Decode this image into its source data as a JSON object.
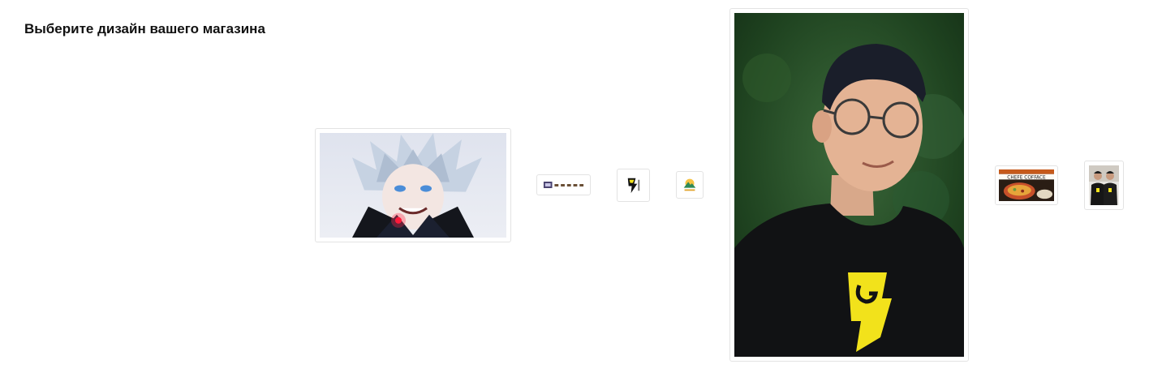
{
  "page": {
    "title": "Выберите дизайн вашего магазина"
  },
  "designs": [
    {
      "icon": "anime-character-thumbnail"
    },
    {
      "icon": "banner-strip-thumbnail"
    },
    {
      "icon": "bolt-logo-thumbnail"
    },
    {
      "icon": "mountain-logo-thumbnail"
    },
    {
      "icon": "portrait-photo-thumbnail"
    },
    {
      "icon": "food-banner-thumbnail",
      "caption": "CHEFE COFFACE"
    },
    {
      "icon": "two-people-photo-thumbnail"
    }
  ],
  "colors": {
    "border": "#e3e3e3",
    "brand_yellow": "#f2e21b",
    "background": "#ffffff"
  }
}
